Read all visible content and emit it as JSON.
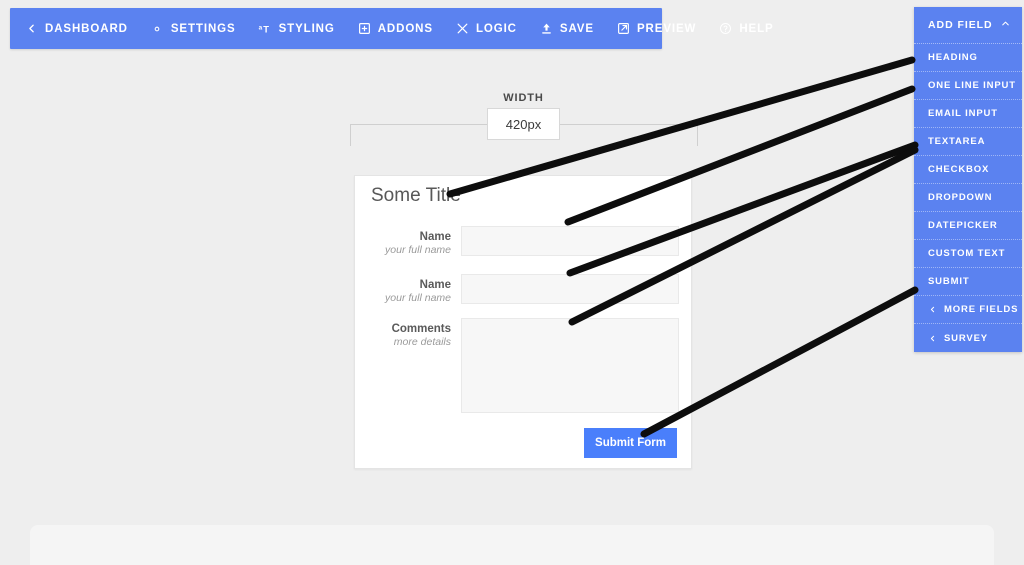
{
  "toolbar": {
    "items": [
      {
        "label": "DASHBOARD",
        "icon": "chevron-left-icon"
      },
      {
        "label": "SETTINGS",
        "icon": "gear-icon"
      },
      {
        "label": "STYLING",
        "icon": "text-size-icon"
      },
      {
        "label": "ADDONS",
        "icon": "plus-box-icon"
      },
      {
        "label": "LOGIC",
        "icon": "shuffle-icon"
      },
      {
        "label": "SAVE",
        "icon": "upload-icon"
      },
      {
        "label": "PREVIEW",
        "icon": "external-link-icon"
      },
      {
        "label": "HELP",
        "icon": "question-circle-icon"
      }
    ],
    "background_color": "#5b82f0",
    "text_color": "#ffffff"
  },
  "add_field_panel": {
    "header": {
      "title": "ADD FIELD",
      "icon": "chevron-up-icon"
    },
    "items": [
      {
        "label": "HEADING",
        "icon": ""
      },
      {
        "label": "ONE LINE INPUT",
        "icon": ""
      },
      {
        "label": "EMAIL INPUT",
        "icon": ""
      },
      {
        "label": "TEXTAREA",
        "icon": ""
      },
      {
        "label": "CHECKBOX",
        "icon": ""
      },
      {
        "label": "DROPDOWN",
        "icon": ""
      },
      {
        "label": "DATEPICKER",
        "icon": ""
      },
      {
        "label": "CUSTOM TEXT",
        "icon": ""
      },
      {
        "label": "SUBMIT",
        "icon": ""
      },
      {
        "label": "MORE FIELDS",
        "icon": "chevron-left-icon"
      },
      {
        "label": "SURVEY",
        "icon": "chevron-left-icon"
      }
    ],
    "background_color": "#5b82f0"
  },
  "width_control": {
    "label": "WIDTH",
    "value": "420px"
  },
  "form": {
    "title": "Some Title",
    "fields": [
      {
        "label": "Name",
        "sublabel": "your full name",
        "value": "",
        "type": "text"
      },
      {
        "label": "Name",
        "sublabel": "your full name",
        "value": "",
        "type": "text"
      },
      {
        "label": "Comments",
        "sublabel": "more details",
        "value": "",
        "type": "textarea"
      }
    ],
    "submit_label": "Submit Form",
    "submit_color": "#4a7ffb"
  },
  "canvas": {
    "background_color": "#eeeeee"
  }
}
